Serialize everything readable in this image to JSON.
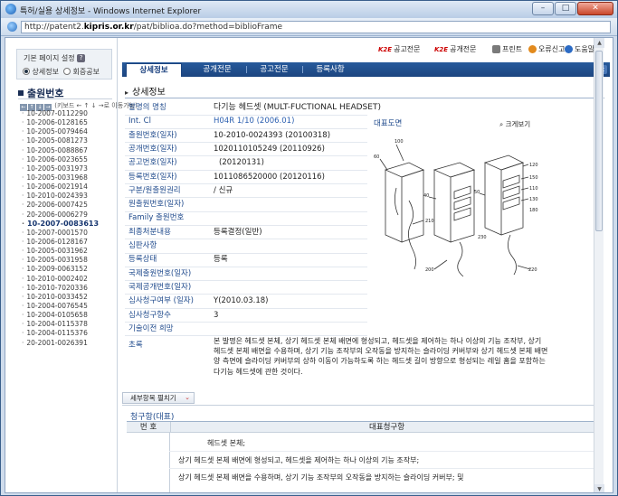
{
  "window": {
    "title": "특허/실용 상세정보 - Windows Internet Explorer",
    "url_prefix": "http://patent2.",
    "url_domain": "kipris.or.kr",
    "url_path": "/pat/biblioa.do?method=biblioFrame",
    "controls": {
      "minimize": "–",
      "maximize": "□",
      "close": "✕"
    }
  },
  "sidebar": {
    "setting_label": "기본 페이지 설정",
    "help_glyph": "?",
    "radio_detail": "상세정보",
    "radio_publication": "회증공보",
    "heading": "출원번호",
    "nav_hint": "(키보드 ← ↑ ↓ →로 이동가능)",
    "nav_glyphs": [
      "←",
      "↑",
      "↓",
      "→"
    ],
    "active_index": 12,
    "numbers": [
      "10-2007-0112290",
      "10-2006-0128165",
      "10-2005-0079464",
      "10-2005-0081273",
      "10-2005-0088867",
      "10-2006-0023655",
      "10-2005-0031973",
      "10-2005-0031968",
      "10-2006-0021914",
      "10-2010-0024393",
      "20-2006-0007425",
      "20-2006-0006279",
      "10-2007-0083613",
      "10-2007-0001570",
      "10-2006-0128167",
      "10-2005-0031962",
      "10-2005-0031958",
      "10-2009-0063152",
      "10-2010-0002402",
      "10-2010-7020336",
      "10-2010-0033452",
      "10-2004-0076545",
      "10-2004-0105658",
      "10-2004-0115378",
      "10-2004-0115376",
      "20-2001-0026391"
    ]
  },
  "toplinks": {
    "kze": "K2E",
    "pub_full": "공고전문",
    "open_full": "공개전문",
    "print": "프린트",
    "error_report": "오류신고",
    "help": "도움말"
  },
  "tabs": [
    "상세정보",
    "공개전문",
    "공고전문",
    "등록사항"
  ],
  "tabbar_close": "x",
  "section_title": "상세정보",
  "info": [
    {
      "label": "발명의 명칭",
      "value": "다기능 헤드셋 (MULT-FUCTIONAL HEADSET)"
    },
    {
      "label": "Int. Cl",
      "value": "H04R 1/10 (2006.01)"
    },
    {
      "label": "출원번호(일자)",
      "value": "10-2010-0024393 (20100318)"
    },
    {
      "label": "공개번호(일자)",
      "value": "1020110105249 (20110926)"
    },
    {
      "label": "공고번호(일자)",
      "value": "(20120131)"
    },
    {
      "label": "등록번호(일자)",
      "value": "1011086520000 (20120116)"
    },
    {
      "label": "구분/원출원권리",
      "value": "/ 신규"
    },
    {
      "label": "원출원번호(일자)",
      "value": ""
    },
    {
      "label": "Family 출원번호",
      "value": ""
    },
    {
      "label": "최종처분내용",
      "value": "등록결정(일반)"
    },
    {
      "label": "심판사항",
      "value": ""
    },
    {
      "label": "등록상태",
      "value": "등록"
    },
    {
      "label": "국제출원번호(일자)",
      "value": ""
    },
    {
      "label": "국제공개번호(일자)",
      "value": ""
    },
    {
      "label": "심사청구여부 (일자)",
      "value": "Y(2010.03.18)"
    },
    {
      "label": "심사청구항수",
      "value": "3"
    },
    {
      "label": "기술이전 희망",
      "value": ""
    }
  ],
  "figure": {
    "title": "대표도면",
    "zoom": "크게보기",
    "refs": [
      "100",
      "60",
      "40",
      "50",
      "210",
      "200",
      "220",
      "230",
      "120",
      "150",
      "110",
      "130",
      "180"
    ]
  },
  "abstract": {
    "label": "초록",
    "text": "본 발명은 헤드셋 본체, 상기 헤드셋 본체 배면에 형성되고, 헤드셋을 제어하는 하나 이상의 기능 조작부, 상기 헤드셋 본체 배면을 수용하며, 상기 기능 조작부의 오작동을 방지하는 슬라이딩 커버부와 상기 헤드셋 본체 배면 양 측면에 슬라이딩 커버부의 상하 이동이 가능하도록 하는 헤드셋 길이 방향으로 형성되는 레일 홈을 포함하는 다기능 헤드셋에 관한 것이다."
  },
  "detail_toggle": {
    "label": "세부항목 펼치기",
    "chevron": "⌄"
  },
  "claims": {
    "title": "청구항(대표)",
    "col_no": "번 호",
    "col_rep": "대표청구항",
    "lines": [
      "헤드셋 본체;",
      "상기 헤드셋 본체 배면에 형성되고, 헤드셋을 제어하는 하나 이상의 기능 조작부;",
      "상기 헤드셋 본체 배면을 수용하며, 상기 기능 조작부의 오작동을 방지하는 슬라이딩 커버부; 및"
    ]
  },
  "scroll": {
    "up": "▲",
    "down": "▼"
  },
  "colors": {
    "tab_bar": "#1c4580",
    "label_blue": "#1f4a8c",
    "link_blue": "#2b5fb0",
    "window_frame": "#3a5f8c"
  }
}
